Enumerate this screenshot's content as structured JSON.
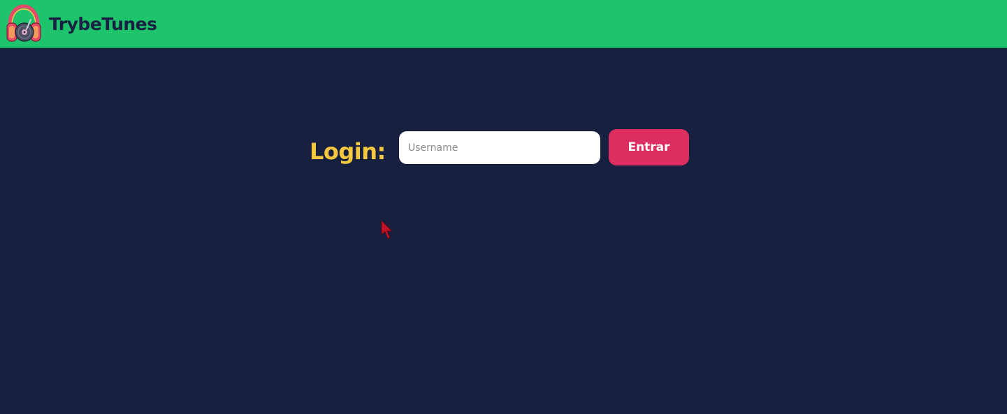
{
  "header": {
    "app_title": "TrybeTunes",
    "logo_icon": "headphones-logo-icon",
    "background_color": "#1dc46c"
  },
  "login": {
    "label": "Login:",
    "username_placeholder": "Username",
    "username_value": "",
    "submit_label": "Entrar"
  },
  "colors": {
    "page_background": "#18203f",
    "label_color": "#f5c840",
    "button_color": "#dd2e62"
  },
  "cursor": {
    "icon": "mouse-pointer-icon",
    "color": "#c2122a"
  }
}
